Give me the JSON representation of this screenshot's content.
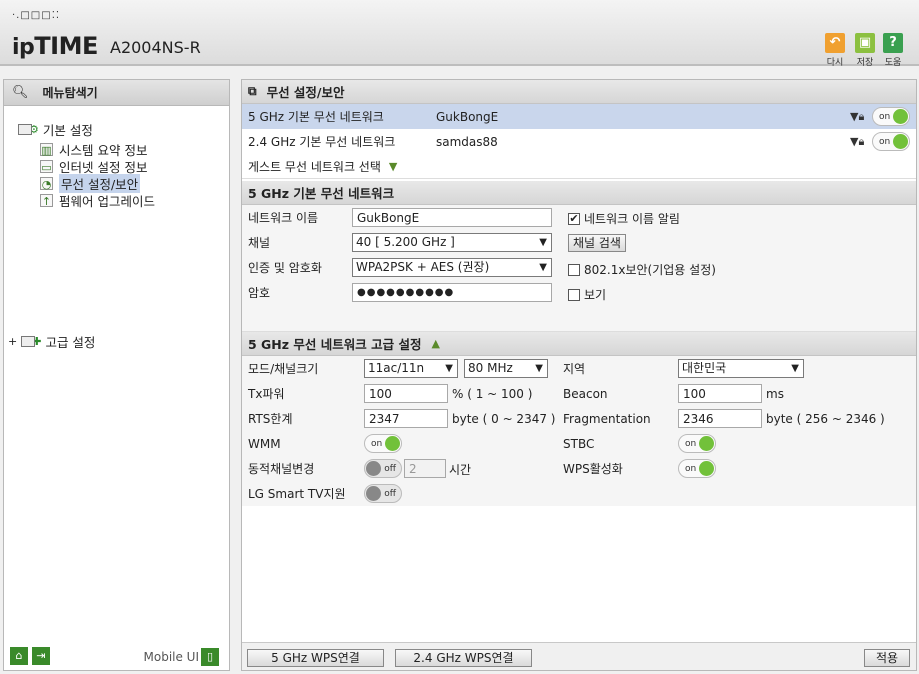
{
  "header": {
    "logo_dots": "·.□□□⁚⁚",
    "brand_prefix": "ip",
    "brand_main": "TIME",
    "model": "A2004NS-R",
    "buttons": {
      "redo": "다시",
      "save": "저장",
      "help": "도움"
    }
  },
  "sidebar": {
    "title": "메뉴탐색기",
    "basic_group": "기본 설정",
    "basic_items": [
      "시스템 요약 정보",
      "인터넷 설정 정보",
      "무선 설정/보안",
      "펌웨어 업그레이드"
    ],
    "active_index": 2,
    "advanced_group": "고급 설정",
    "mobile_ui": "Mobile UI"
  },
  "main": {
    "section_title": "무선 설정/보안",
    "networks": [
      {
        "label": "5 GHz 기본 무선 네트워크",
        "ssid": "GukBongE",
        "toggle": "on"
      },
      {
        "label": "2.4 GHz 기본 무선 네트워크",
        "ssid": "samdas88",
        "toggle": "on"
      }
    ],
    "guest_label": "게스트 무선 네트워크 선택",
    "basic": {
      "title": "5 GHz 기본 무선 네트워크",
      "name_label": "네트워크 이름",
      "name_value": "GukBongE",
      "broadcast_label": "네트워크 이름 알림",
      "channel_label": "채널",
      "channel_value": "40 [ 5.200 GHz ]",
      "scan_button": "채널 검색",
      "auth_label": "인증 및 암호화",
      "auth_value": "WPA2PSK + AES (권장)",
      "dot1x_label": "802.1x보안(기업용 설정)",
      "password_label": "암호",
      "password_value": "●●●●●●●●●●",
      "show_label": "보기"
    },
    "advanced": {
      "title": "5 GHz 무선 네트워크 고급 설정",
      "mode_label": "모드/채널크기",
      "mode_value": "11ac/11n",
      "width_value": "80 MHz",
      "region_label": "지역",
      "region_value": "대한민국",
      "tx_label": "Tx파워",
      "tx_value": "100",
      "tx_unit": "% ( 1 ~ 100 )",
      "beacon_label": "Beacon",
      "beacon_value": "100",
      "beacon_unit": "ms",
      "rts_label": "RTS한계",
      "rts_value": "2347",
      "rts_unit": "byte ( 0 ~ 2347 )",
      "frag_label": "Fragmentation",
      "frag_value": "2346",
      "frag_unit": "byte ( 256 ~ 2346 )",
      "wmm_label": "WMM",
      "stbc_label": "STBC",
      "dyn_label": "동적채널변경",
      "dyn_value": "2",
      "dyn_unit": "시간",
      "wps_label": "WPS활성화",
      "lgtv_label": "LG Smart TV지원"
    },
    "footer": {
      "wps5": "5 GHz WPS연결",
      "wps24": "2.4 GHz WPS연결",
      "apply": "적용"
    }
  },
  "toggle_text": {
    "on": "on",
    "off": "off"
  }
}
